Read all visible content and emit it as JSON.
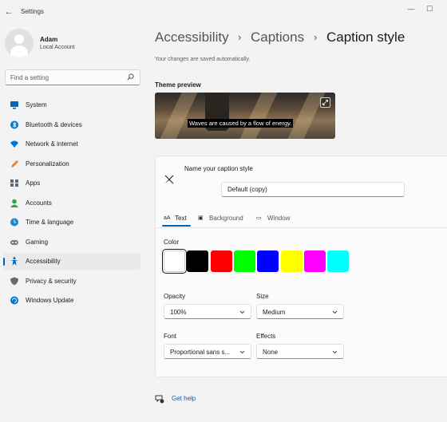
{
  "window": {
    "title": "Settings"
  },
  "profile": {
    "name": "Adam",
    "account": "Local Account"
  },
  "search": {
    "placeholder": "Find a setting"
  },
  "sidebar": {
    "items": [
      {
        "label": "System",
        "icon": "monitor-icon",
        "color": "#0067c0"
      },
      {
        "label": "Bluetooth & devices",
        "icon": "bluetooth-icon",
        "color": "#0078d4"
      },
      {
        "label": "Network & internet",
        "icon": "wifi-icon",
        "color": "#0078d4"
      },
      {
        "label": "Personalization",
        "icon": "brush-icon",
        "color": "#e3862d"
      },
      {
        "label": "Apps",
        "icon": "apps-icon",
        "color": "#5b6a7a"
      },
      {
        "label": "Accounts",
        "icon": "person-icon",
        "color": "#2da44e"
      },
      {
        "label": "Time & language",
        "icon": "globe-clock-icon",
        "color": "#1e88c8"
      },
      {
        "label": "Gaming",
        "icon": "controller-icon",
        "color": "#7a7a7a"
      },
      {
        "label": "Accessibility",
        "icon": "accessibility-icon",
        "color": "#0067c0"
      },
      {
        "label": "Privacy & security",
        "icon": "shield-icon",
        "color": "#6b6b6b"
      },
      {
        "label": "Windows Update",
        "icon": "update-icon",
        "color": "#0078d4"
      }
    ],
    "active_index": 8
  },
  "breadcrumb": {
    "items": [
      "Accessibility",
      "Captions",
      "Caption style"
    ]
  },
  "autosave_note": "Your changes are saved automatically.",
  "preview": {
    "heading": "Theme preview",
    "caption_text": "Waves are caused by a flow of energy."
  },
  "style_name": {
    "label": "Name your caption style",
    "value": "Default (copy)"
  },
  "tabs": [
    {
      "label": "Text",
      "icon": "text-aa-icon",
      "glyph": "aA"
    },
    {
      "label": "Background",
      "icon": "background-icon",
      "glyph": "▣"
    },
    {
      "label": "Window",
      "icon": "window-icon",
      "glyph": "▭"
    }
  ],
  "color": {
    "label": "Color",
    "swatches": [
      "#ffffff",
      "#000000",
      "#ff0000",
      "#00ff00",
      "#0000ff",
      "#ffff00",
      "#ff00ff",
      "#00ffff"
    ],
    "selected_index": 0
  },
  "opacity": {
    "label": "Opacity",
    "value": "100%"
  },
  "size": {
    "label": "Size",
    "value": "Medium"
  },
  "font": {
    "label": "Font",
    "value": "Proportional sans s..."
  },
  "effects": {
    "label": "Effects",
    "value": "None"
  },
  "help": {
    "label": "Get help"
  },
  "colors": {
    "accent": "#005fb8",
    "background": "#f3f3f3",
    "card": "#fbfbfb"
  }
}
